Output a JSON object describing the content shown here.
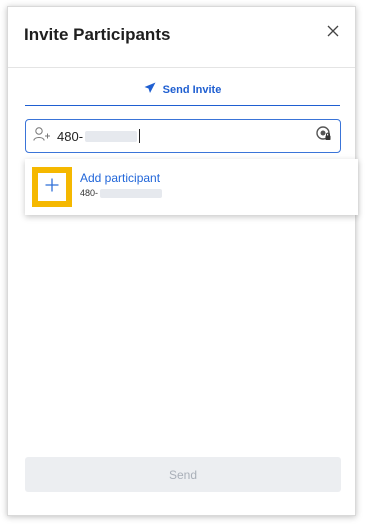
{
  "dialog": {
    "title": "Invite Participants"
  },
  "tabs": [
    {
      "label": "Send Invite",
      "icon": "send-icon",
      "active": true
    }
  ],
  "participant_field": {
    "value_prefix": "480-",
    "left_icon": "add-person-icon",
    "right_icon": "privacy-lock-icon"
  },
  "suggestion": {
    "title": "Add participant",
    "subtitle_prefix": "480-",
    "icon": "plus-icon"
  },
  "footer": {
    "send_label": "Send",
    "send_enabled": false
  },
  "colors": {
    "accent": "#1f5fd1",
    "highlight": "#f5b800",
    "disabled_button_bg": "#eceef1",
    "disabled_button_text": "#a9afb8"
  }
}
